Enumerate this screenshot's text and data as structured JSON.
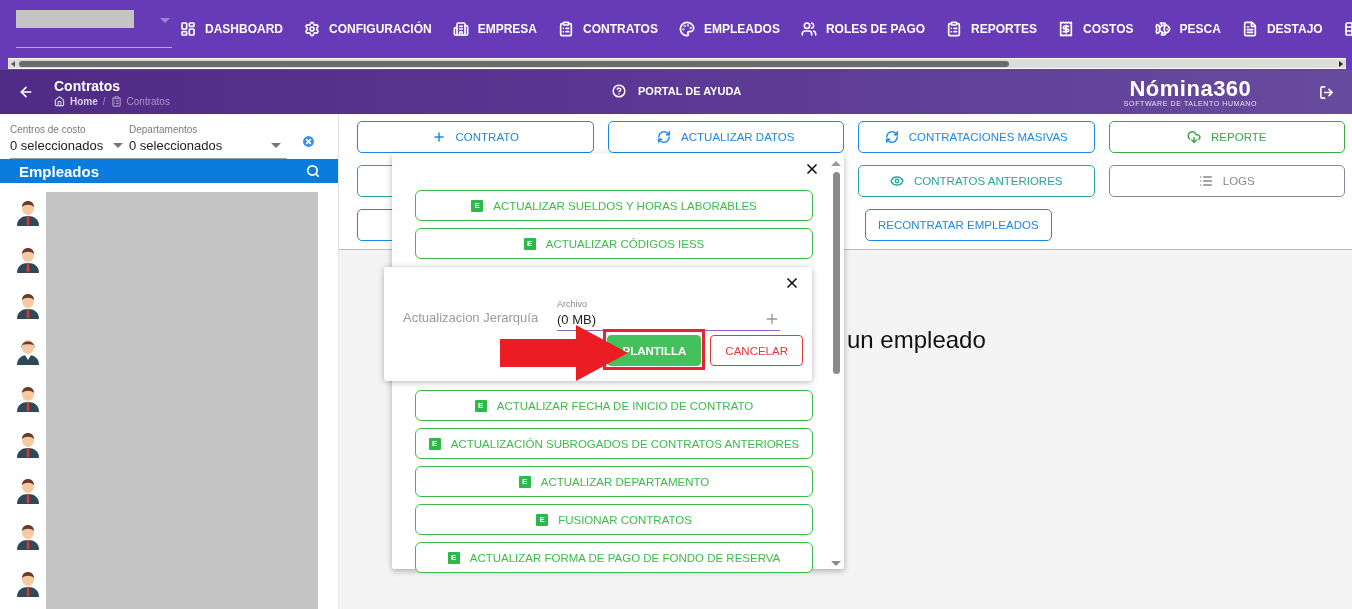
{
  "top_nav": {
    "items": [
      {
        "label": "DASHBOARD"
      },
      {
        "label": "CONFIGURACIÓN"
      },
      {
        "label": "EMPRESA"
      },
      {
        "label": "CONTRATOS"
      },
      {
        "label": "EMPLEADOS"
      },
      {
        "label": "ROLES DE PAGO"
      },
      {
        "label": "REPORTES"
      },
      {
        "label": "COSTOS"
      },
      {
        "label": "PESCA"
      },
      {
        "label": "DESTAJO"
      }
    ]
  },
  "page_header": {
    "title": "Contratos",
    "breadcrumb_separator": "/",
    "breadcrumb": [
      {
        "label": "Home",
        "selected": false
      },
      {
        "label": "Contratos",
        "selected": true
      }
    ],
    "help_link": "PORTAL DE AYUDA",
    "logo": {
      "name": "Nómina360",
      "tagline": "SOFTWARE DE TALENTO HUMANO"
    }
  },
  "filters": [
    {
      "label": "Centros de costo",
      "value": "0 seleccionados"
    },
    {
      "label": "Departamentos",
      "value": "0 seleccionados"
    }
  ],
  "employees_panel": {
    "title": "Empleados",
    "employees": [
      {
        "kind": "male"
      },
      {
        "kind": "male"
      },
      {
        "kind": "male"
      },
      {
        "kind": "female"
      },
      {
        "kind": "male"
      },
      {
        "kind": "male"
      },
      {
        "kind": "male"
      },
      {
        "kind": "male"
      },
      {
        "kind": "male"
      }
    ]
  },
  "toolbar": [
    {
      "label": "CONTRATO",
      "color": "#1e88e5"
    },
    {
      "label": "ACTUALIZAR DATOS",
      "color": "#1e88e5"
    },
    {
      "label": "CONTRATACIONES MASIVAS",
      "color": "#1e88e5"
    },
    {
      "label": "REPORTE",
      "color": "#3aa84a"
    },
    {
      "color": "#26a69a"
    },
    {
      "label": "CONTRATOS ANTERIORES",
      "color": "#26a69a"
    },
    {
      "label": "LOGS",
      "color": "#8a8690"
    },
    {
      "color": "#1e88e5"
    },
    {
      "label": "RECONTRATAR EMPLEADOS",
      "color": "#1e88e5"
    }
  ],
  "message": "un empleado",
  "bulk_dialog": {
    "items_before": [
      {
        "badge": "E",
        "label": "ACTUALIZAR SUELDOS Y HORAS LABORABLES"
      },
      {
        "badge": "E",
        "label": "ACTUALIZAR CÓDIGOS IESS"
      }
    ],
    "items_after": [
      {
        "badge": "E",
        "label": "ACTUALIZAR FECHA DE INICIO DE CONTRATO"
      },
      {
        "badge": "E",
        "label": "ACTUALIZACIÓN SUBROGADOS DE CONTRATOS ANTERIORES"
      },
      {
        "badge": "E",
        "label": "ACTUALIZAR DEPARTAMENTO"
      },
      {
        "badge": "E",
        "label": "FUSIONAR CONTRATOS"
      },
      {
        "badge": "E",
        "label": "ACTUALIZAR FORMA DE PAGO DE FONDO DE RESERVA"
      }
    ]
  },
  "upload_dialog": {
    "title": "Actualizacion Jerarquía",
    "file_field": {
      "label": "Archivo",
      "value": "(0 MB)"
    },
    "buttons": [
      {
        "label": "PLANTILLA",
        "kind": "primary",
        "highlighted": true
      },
      {
        "label": "CANCELAR",
        "kind": "cancel",
        "highlighted": false
      }
    ]
  }
}
